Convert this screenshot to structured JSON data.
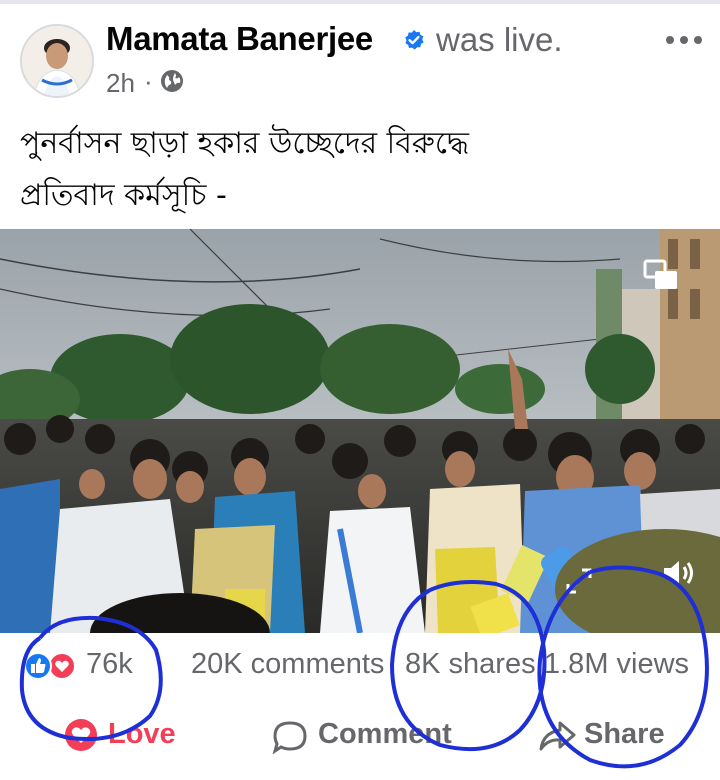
{
  "post": {
    "author": "Mamata Banerjee",
    "status": "was live.",
    "time": "2h",
    "separator": "·",
    "audience_icon": "globe-icon",
    "caption_line1": "পুনর্বাসন ছাড়া হকার উচ্ছেদের বিরুদ্ধে",
    "caption_line2": "প্রতিবাদ কর্মসূচি -"
  },
  "stats": {
    "reactions": "76k",
    "comments": "20K comments",
    "shares": "8K shares",
    "views": "1.8M views"
  },
  "actions": {
    "love": "Love",
    "comment": "Comment",
    "share": "Share"
  },
  "colors": {
    "facebook_blue": "#1877f2",
    "love_red": "#f33e58",
    "muted_text": "#65676b",
    "annotation_blue": "#1f2fd6"
  }
}
